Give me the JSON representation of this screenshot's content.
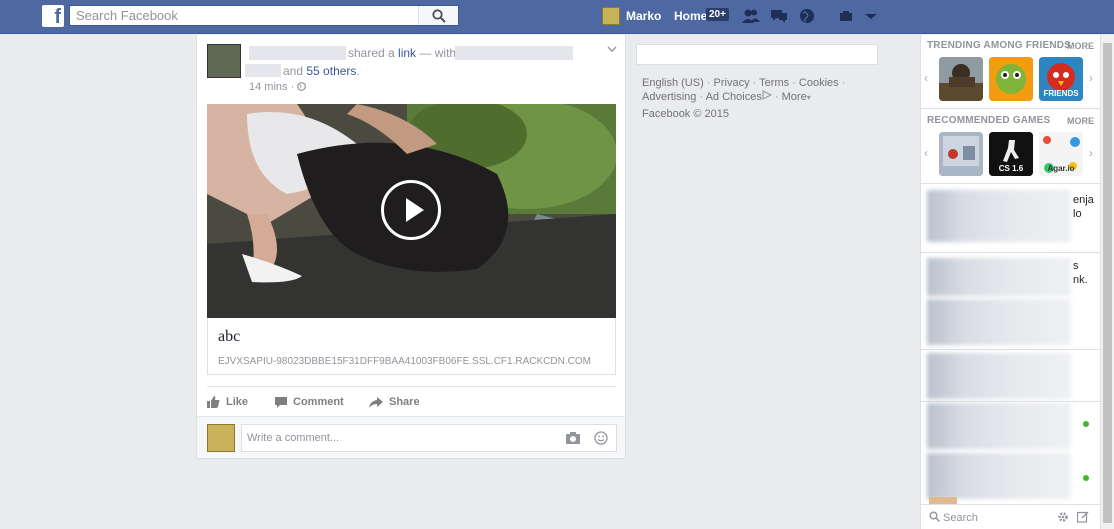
{
  "header": {
    "logo": "f",
    "search_placeholder": "Search Facebook",
    "user_name": "Marko",
    "home_label": "Home",
    "home_badge": "20+"
  },
  "post": {
    "shared_text": "shared a",
    "shared_link": "link",
    "with_text": "— with",
    "and_text": "and",
    "others_link": "55 others",
    "period": ".",
    "time": "14 mins",
    "link_title": "abc",
    "link_url": "EJVXSAPIU-98023DBBE15F31DFF9BAA41003FB06FE.SSL.CF1.RACKCDN.COM",
    "actions": {
      "like": "Like",
      "comment": "Comment",
      "share": "Share"
    },
    "comment_placeholder": "Write a comment..."
  },
  "footer": {
    "links": [
      "English (US)",
      "Privacy",
      "Terms",
      "Cookies",
      "Advertising",
      "Ad Choices",
      "More"
    ],
    "copyright": "Facebook © 2015"
  },
  "sidebar": {
    "trending_title": "TRENDING AMONG FRIENDS",
    "trending_more": "MORE",
    "trending_games": [
      {
        "label": "",
        "color": "#6b5a3a"
      },
      {
        "label": "",
        "color": "#5f9c2e"
      },
      {
        "label": "FRIENDS",
        "color": "#c0392b"
      }
    ],
    "recommended_title": "RECOMMENDED GAMES",
    "recommended_more": "MORE",
    "recommended_games": [
      {
        "label": "",
        "color": "#8b9ab0"
      },
      {
        "label": "CS 1.6",
        "color": "#111111"
      },
      {
        "label": "Agar.io",
        "color": "#f4f4f4"
      }
    ],
    "chat_snippets": [
      "enja",
      "lo",
      "s",
      "nk."
    ],
    "chat_search_placeholder": "Search"
  },
  "colors": {
    "topbar": "#4e69a2",
    "link": "#365899",
    "online": "#42b72a"
  }
}
